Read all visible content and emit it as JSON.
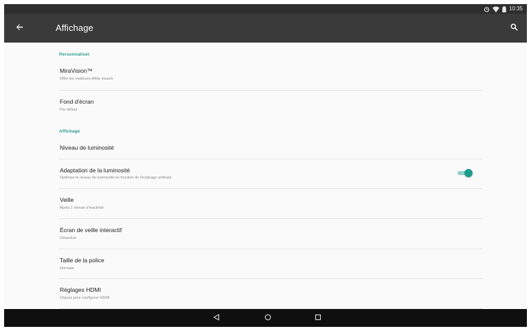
{
  "status_bar": {
    "time": "10:35",
    "icons": [
      "alarm-icon",
      "wifi-icon",
      "battery-icon"
    ]
  },
  "app_bar": {
    "title": "Affichage",
    "back_icon": "arrow-back-icon",
    "search_icon": "search-icon"
  },
  "sections": [
    {
      "header": "Personnaliser",
      "items": [
        {
          "title": "MiraVision™",
          "subtitle": "Offre les meilleurs effets visuels"
        },
        {
          "title": "Fond d'écran",
          "subtitle": "Par défaut"
        }
      ]
    },
    {
      "header": "Affichage",
      "items": [
        {
          "title": "Niveau de luminosité",
          "subtitle": ""
        },
        {
          "title": "Adaptation de la luminosité",
          "subtitle": "Optimise le niveau de luminosité en fonction de l'éclairage ambiant",
          "toggle_on": true
        },
        {
          "title": "Veille",
          "subtitle": "Après 1 minute d'inactivité"
        },
        {
          "title": "Écran de veille interactif",
          "subtitle": "Désactivé"
        },
        {
          "title": "Taille de la police",
          "subtitle": "Normale"
        },
        {
          "title": "Réglages HDMI",
          "subtitle": "Cliquez pour configurer HDMI"
        }
      ]
    }
  ],
  "nav_bar": {
    "icons": [
      "back-triangle-icon",
      "home-circle-icon",
      "recents-square-icon"
    ]
  },
  "colors": {
    "accent": "#2a9d8f",
    "toggle_thumb": "#1e9b8c",
    "toggle_track": "#8fd1c6",
    "app_bar": "#3a3a3a",
    "status_bar": "#2e2e2e",
    "nav_bar": "#0f0f0f"
  }
}
